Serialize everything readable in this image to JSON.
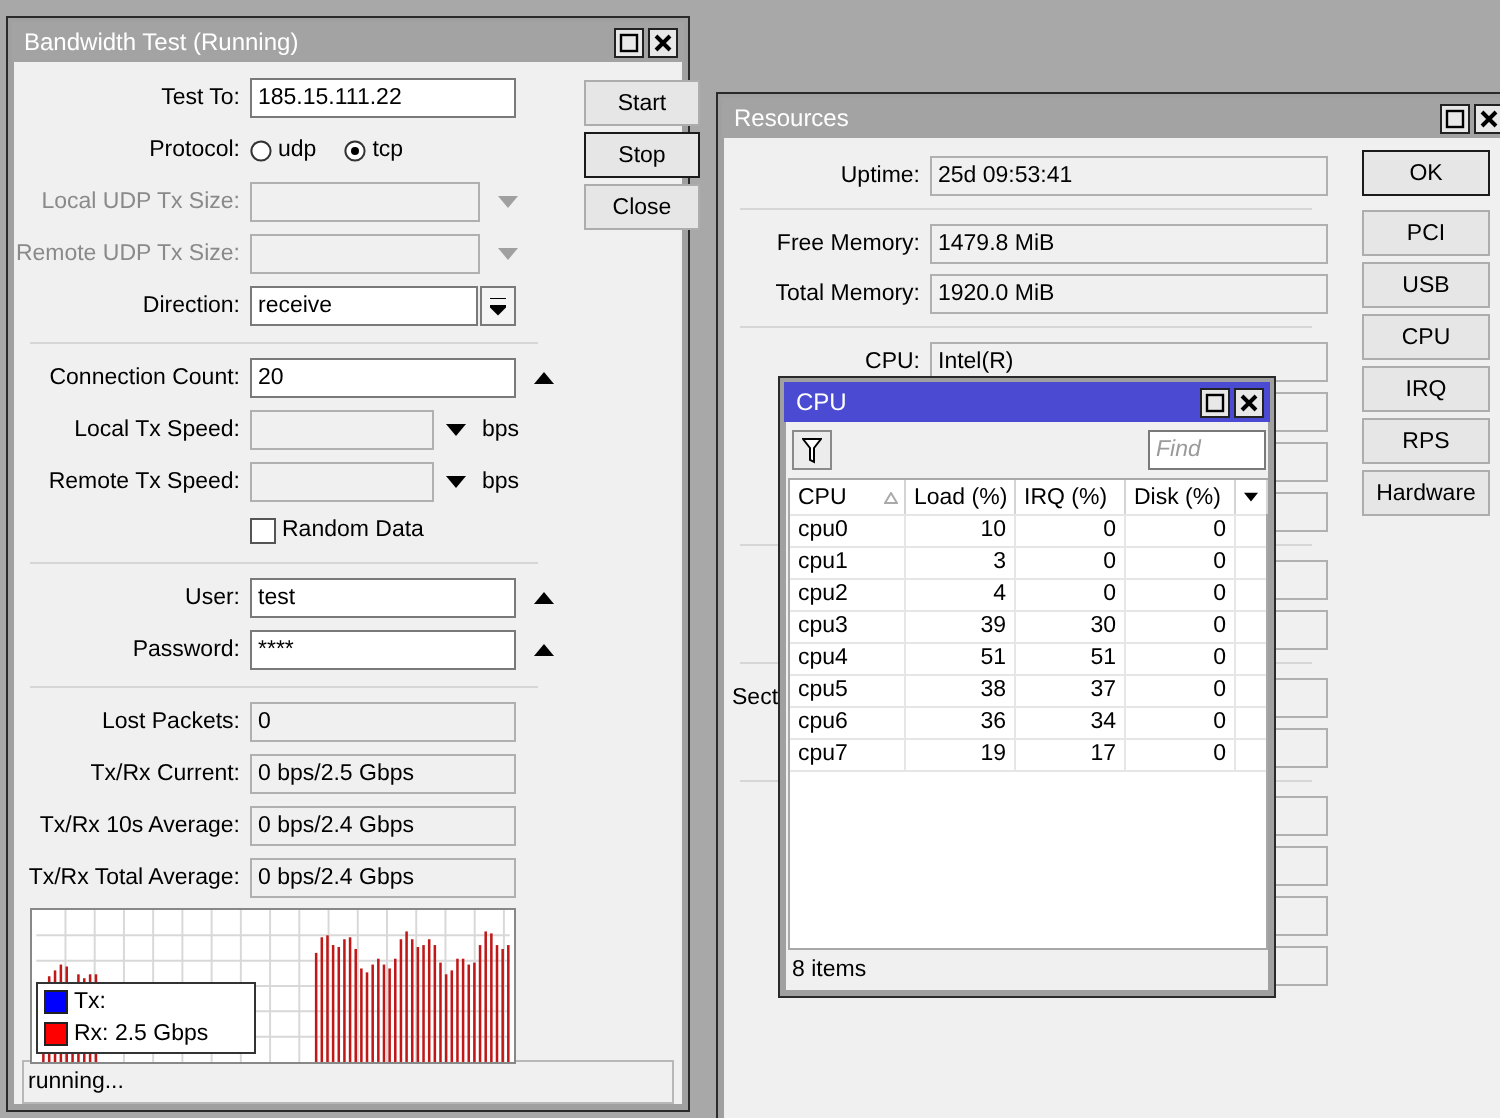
{
  "bandwidth_test": {
    "title": "Bandwidth Test (Running)",
    "active": false,
    "rows": [
      {
        "kind": "input",
        "label": "Test To:",
        "value": "185.15.111.22",
        "disabled": false
      },
      {
        "kind": "radio",
        "label": "Protocol:",
        "options": [
          {
            "label": "udp",
            "selected": false
          },
          {
            "label": "tcp",
            "selected": true
          }
        ]
      },
      {
        "kind": "dropdown",
        "label": "Local UDP Tx Size:",
        "disabled": true
      },
      {
        "kind": "dropdown",
        "label": "Remote UDP Tx Size:",
        "disabled": true
      },
      {
        "kind": "combo",
        "label": "Direction:",
        "value": "receive",
        "disabled": false
      },
      {
        "kind": "separator"
      },
      {
        "kind": "collapse",
        "label": "Connection Count:",
        "value": "20",
        "disabled": false
      },
      {
        "kind": "speed",
        "label": "Local Tx Speed:",
        "unit": "bps",
        "disabled": false
      },
      {
        "kind": "speed",
        "label": "Remote Tx Speed:",
        "unit": "bps",
        "disabled": false
      },
      {
        "kind": "checkbox",
        "label": "Random Data",
        "checked": false
      },
      {
        "kind": "separator"
      },
      {
        "kind": "collapse",
        "label": "User:",
        "value": "test",
        "disabled": false
      },
      {
        "kind": "collapse",
        "label": "Password:",
        "value": "****",
        "disabled": false
      },
      {
        "kind": "separator"
      },
      {
        "kind": "readonly",
        "label": "Lost Packets:",
        "value": "0"
      },
      {
        "kind": "readonly",
        "label": "Tx/Rx Current:",
        "value": "0 bps/2.5 Gbps"
      },
      {
        "kind": "readonly",
        "label": "Tx/Rx 10s Average:",
        "value": "0 bps/2.4 Gbps"
      },
      {
        "kind": "readonly",
        "label": "Tx/Rx Total Average:",
        "value": "0 bps/2.4 Gbps"
      }
    ],
    "buttons": [
      {
        "label": "Start",
        "focused": false
      },
      {
        "label": "Stop",
        "focused": true
      },
      {
        "label": "Close",
        "focused": false
      }
    ],
    "graph": {
      "legend": [
        {
          "label": "Tx:",
          "color": "#0000ff"
        },
        {
          "label": "Rx:",
          "value": "2.5 Gbps",
          "color": "#ff0000"
        }
      ]
    },
    "status_bar": "running..."
  },
  "resources": {
    "title": "Resources",
    "active": false,
    "rows": [
      {
        "kind": "field",
        "label": "Uptime:",
        "value": "25d 09:53:41"
      },
      {
        "kind": "separator"
      },
      {
        "kind": "field",
        "label": "Free Memory:",
        "value": "1479.8 MiB"
      },
      {
        "kind": "field",
        "label": "Total Memory:",
        "value": "1920.0 MiB"
      },
      {
        "kind": "separator"
      },
      {
        "kind": "field",
        "label": "CPU:",
        "value": "Intel(R)"
      },
      {
        "kind": "field"
      },
      {
        "kind": "field"
      },
      {
        "kind": "field"
      },
      {
        "kind": "separator"
      },
      {
        "kind": "field"
      },
      {
        "kind": "field"
      },
      {
        "kind": "separator"
      },
      {
        "kind": "field",
        "label": "Sect",
        "label_cut": true
      },
      {
        "kind": "field"
      },
      {
        "kind": "separator"
      },
      {
        "kind": "field"
      },
      {
        "kind": "field"
      },
      {
        "kind": "field"
      },
      {
        "kind": "field"
      }
    ],
    "buttons": [
      {
        "label": "OK",
        "focused": true
      },
      {
        "label": "PCI",
        "focused": false
      },
      {
        "label": "USB",
        "focused": false
      },
      {
        "label": "CPU",
        "focused": false
      },
      {
        "label": "IRQ",
        "focused": false
      },
      {
        "label": "RPS",
        "focused": false
      },
      {
        "label": "Hardware",
        "focused": false
      }
    ]
  },
  "cpu_window": {
    "title": "CPU",
    "active": true,
    "search": {
      "placeholder": "Find"
    },
    "table": {
      "columns": [
        {
          "label": "CPU",
          "sorted": true
        },
        {
          "label": "Load (%)",
          "sorted": false
        },
        {
          "label": "IRQ (%)",
          "sorted": false
        },
        {
          "label": "Disk (%)",
          "sorted": false
        }
      ],
      "rows": [
        [
          "cpu0",
          "10",
          "0",
          "0"
        ],
        [
          "cpu1",
          "3",
          "0",
          "0"
        ],
        [
          "cpu2",
          "4",
          "0",
          "0"
        ],
        [
          "cpu3",
          "39",
          "30",
          "0"
        ],
        [
          "cpu4",
          "51",
          "51",
          "0"
        ],
        [
          "cpu5",
          "38",
          "37",
          "0"
        ],
        [
          "cpu6",
          "36",
          "34",
          "0"
        ],
        [
          "cpu7",
          "19",
          "17",
          "0"
        ]
      ]
    },
    "status_bar": "8 items"
  }
}
